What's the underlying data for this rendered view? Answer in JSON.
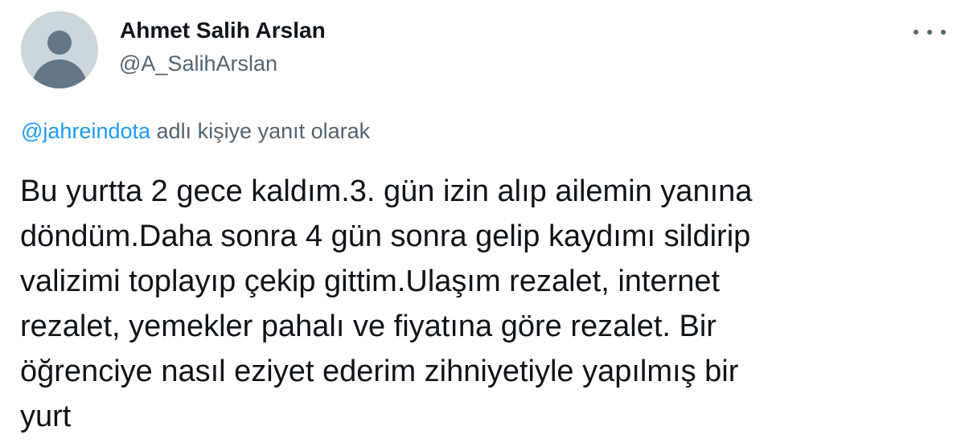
{
  "user": {
    "display_name": "Ahmet Salih Arslan",
    "handle": "@A_SalihArslan"
  },
  "reply": {
    "mention": "@jahreindota",
    "suffix": "adlı kişiye yanıt olarak"
  },
  "tweet": {
    "lines": [
      "Bu yurtta 2 gece kaldım.3. gün izin alıp ailemin yanına",
      "döndüm.Daha sonra 4 gün sonra gelip kaydımı sildirip",
      "valizimi toplayıp çekip gittim.Ulaşım rezalet, internet",
      "rezalet, yemekler pahalı ve fiyatına göre rezalet. Bir",
      "öğrenciye nasıl eziyet ederim zihniyetiyle yapılmış bir",
      "yurt"
    ]
  },
  "icons": {
    "avatar": "default-profile-avatar-icon",
    "more": "more-options-icon"
  },
  "colors": {
    "text": "#0f1419",
    "secondary": "#536471",
    "link": "#1d9bf0",
    "avatar_bg": "#ccd6dd"
  }
}
